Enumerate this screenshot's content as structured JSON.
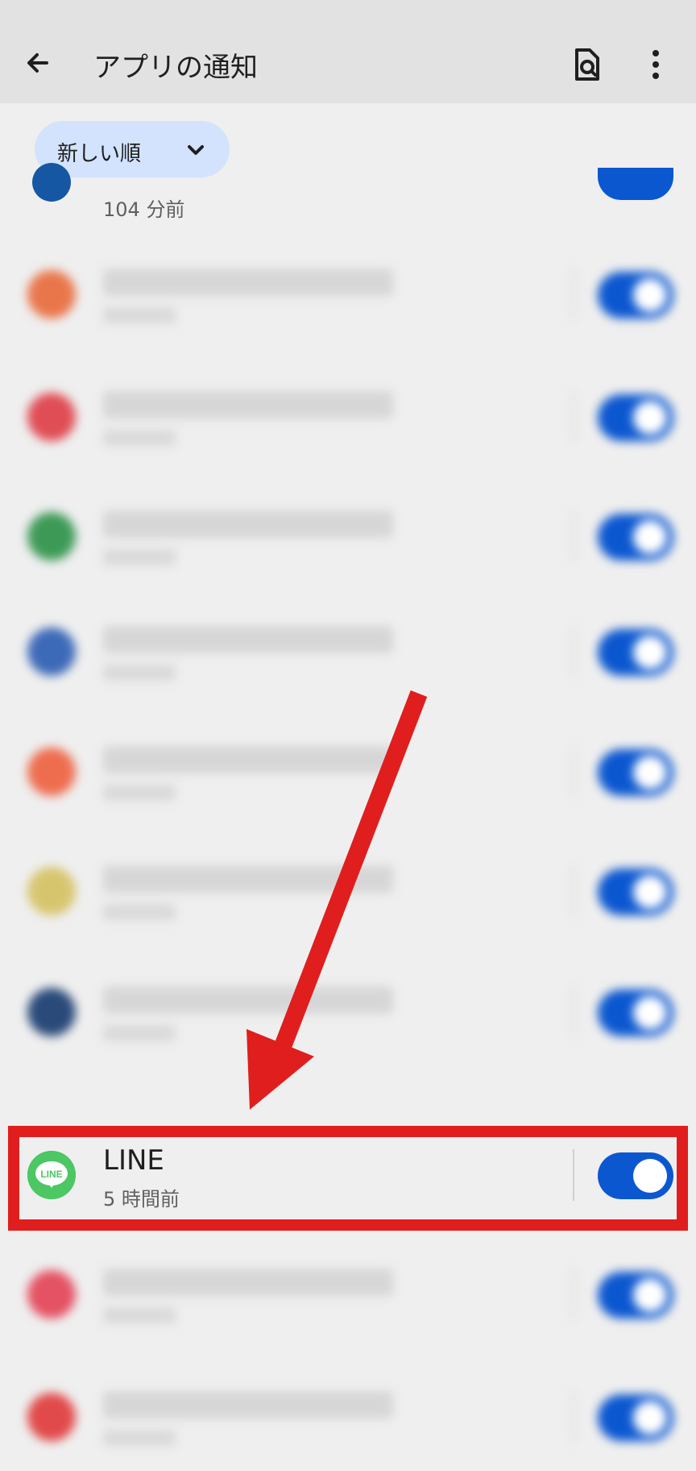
{
  "appbar": {
    "title": "アプリの通知"
  },
  "sort_chip": {
    "label": "新しい順"
  },
  "partial_top_item": {
    "subtitle": "104 分前"
  },
  "apps": [
    {
      "name": "",
      "subtitle": "",
      "color": "#e9764b",
      "enabled": true,
      "blurred": true
    },
    {
      "name": "",
      "subtitle": "",
      "color": "#e04d55",
      "enabled": true,
      "blurred": true
    },
    {
      "name": "",
      "subtitle": "",
      "color": "#3d9a56",
      "enabled": true,
      "blurred": true
    },
    {
      "name": "",
      "subtitle": "",
      "color": "#3d6ab8",
      "enabled": true,
      "blurred": true
    },
    {
      "name": "",
      "subtitle": "",
      "color": "#ee6d4f",
      "enabled": true,
      "blurred": true
    },
    {
      "name": "",
      "subtitle": "",
      "color": "#d7c56e",
      "enabled": true,
      "blurred": true
    },
    {
      "name": "",
      "subtitle": "",
      "color": "#2a4a7a",
      "enabled": true,
      "blurred": true
    },
    {
      "name": "LINE",
      "subtitle": "5 時間前",
      "color": "#4cc764",
      "enabled": true,
      "blurred": false
    },
    {
      "name": "",
      "subtitle": "",
      "color": "#e45263",
      "enabled": true,
      "blurred": true
    },
    {
      "name": "",
      "subtitle": "",
      "color": "#e14a4a",
      "enabled": true,
      "blurred": true
    }
  ],
  "line_icon_text": "LINE"
}
